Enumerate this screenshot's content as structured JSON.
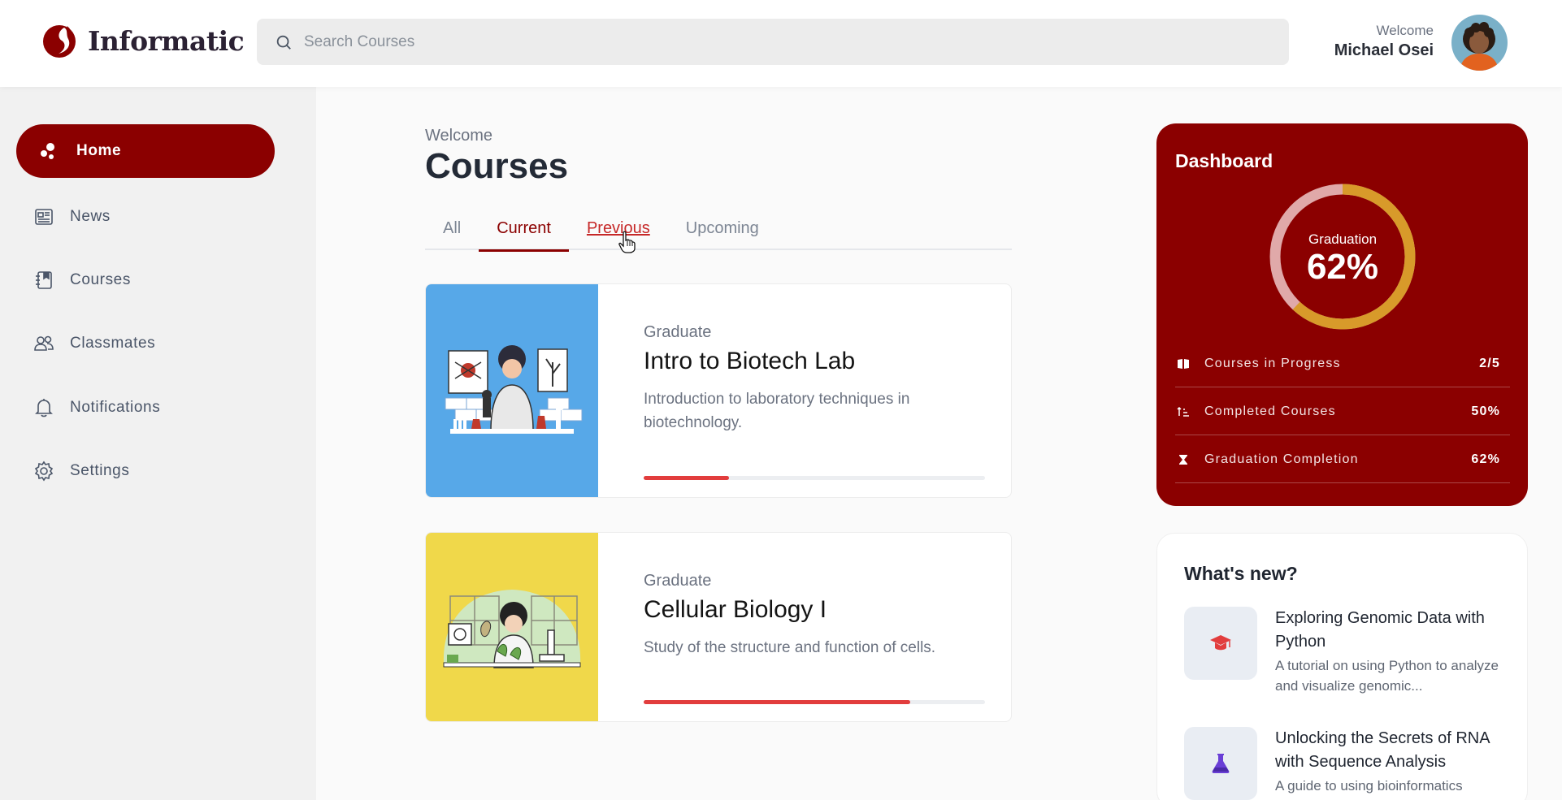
{
  "brand": {
    "name": "Informatic",
    "logo_icon": "informatic-logo-icon"
  },
  "search": {
    "placeholder": "Search Courses",
    "icon": "search-icon"
  },
  "user": {
    "welcome": "Welcome",
    "name": "Michael Osei"
  },
  "sidebar": {
    "items": [
      {
        "label": "Home",
        "icon": "home-dots-icon",
        "active": true
      },
      {
        "label": "News",
        "icon": "newspaper-icon"
      },
      {
        "label": "Courses",
        "icon": "notebook-icon"
      },
      {
        "label": "Classmates",
        "icon": "people-icon"
      },
      {
        "label": "Notifications",
        "icon": "bell-icon"
      },
      {
        "label": "Settings",
        "icon": "gear-icon"
      }
    ]
  },
  "main": {
    "welcome": "Welcome",
    "title": "Courses",
    "tabs": [
      {
        "label": "All"
      },
      {
        "label": "Current",
        "active": true
      },
      {
        "label": "Previous",
        "hovered": true
      },
      {
        "label": "Upcoming"
      }
    ],
    "courses": [
      {
        "level": "Graduate",
        "title": "Intro to Biotech Lab",
        "description": "Introduction to laboratory techniques in biotechnology.",
        "progress": 0.25,
        "image_bg": "#57a8e8"
      },
      {
        "level": "Graduate",
        "title": "Cellular Biology I",
        "description": "Study of the structure and function of cells.",
        "progress": 0.78,
        "image_bg": "#f0d84a"
      }
    ]
  },
  "dashboard": {
    "title": "Dashboard",
    "donut": {
      "label": "Graduation",
      "value_text": "62%",
      "value": 0.62
    },
    "stats": [
      {
        "icon": "book-open-icon",
        "label": "Courses in Progress",
        "value": "2/5"
      },
      {
        "icon": "sort-ascending-icon",
        "label": "Completed Courses",
        "value": "50%"
      },
      {
        "icon": "hourglass-icon",
        "label": "Graduation Completion",
        "value": "62%"
      }
    ]
  },
  "whats_new": {
    "title": "What's new?",
    "items": [
      {
        "icon": "graduation-cap-icon",
        "title": "Exploring Genomic Data with Python",
        "body": "A tutorial on using Python to analyze and visualize genomic..."
      },
      {
        "icon": "flask-icon",
        "title": "Unlocking the Secrets of RNA with Sequence Analysis",
        "body": "A guide to using bioinformatics"
      }
    ]
  },
  "colors": {
    "brand": "#8b0000",
    "progress": "#e23d3d",
    "donut_fill": "#d89a2a",
    "donut_track": "#e8b8b8"
  }
}
